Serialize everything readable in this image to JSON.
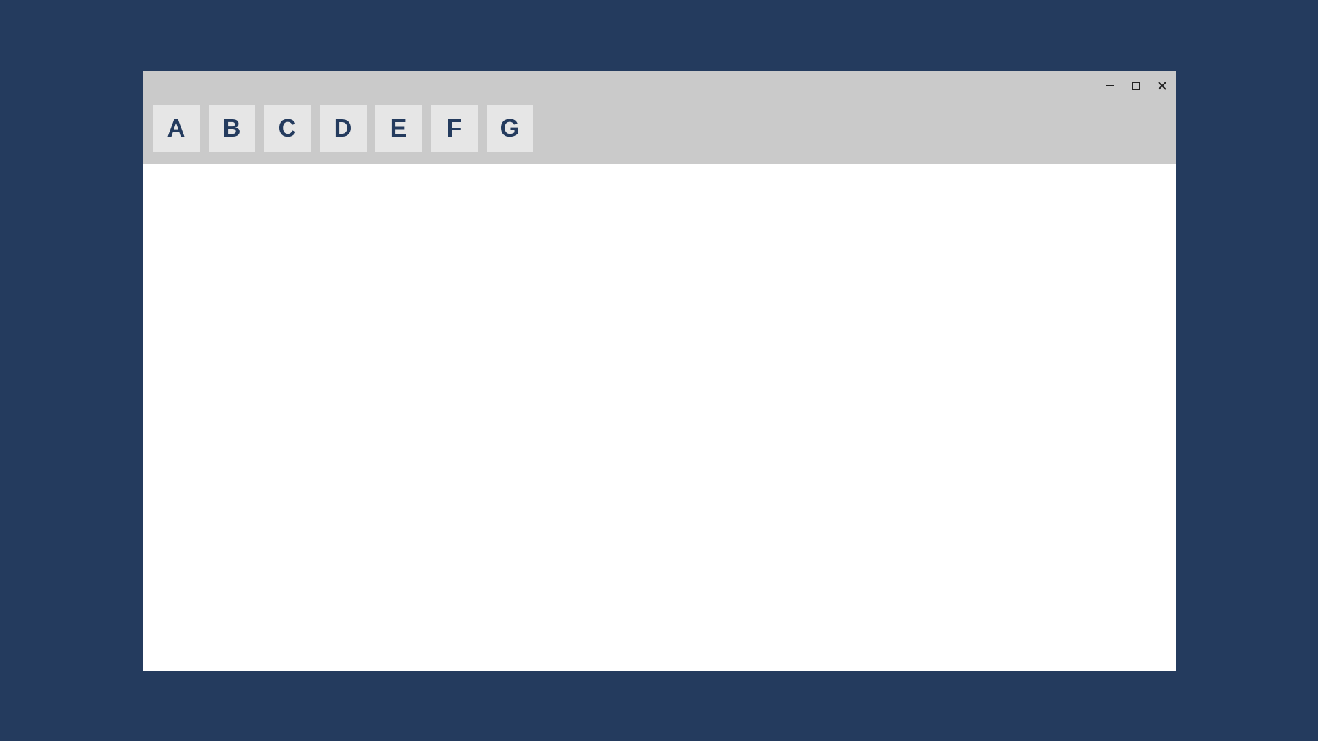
{
  "toolbar": {
    "buttons": [
      {
        "label": "A"
      },
      {
        "label": "B"
      },
      {
        "label": "C"
      },
      {
        "label": "D"
      },
      {
        "label": "E"
      },
      {
        "label": "F"
      },
      {
        "label": "G"
      }
    ]
  }
}
